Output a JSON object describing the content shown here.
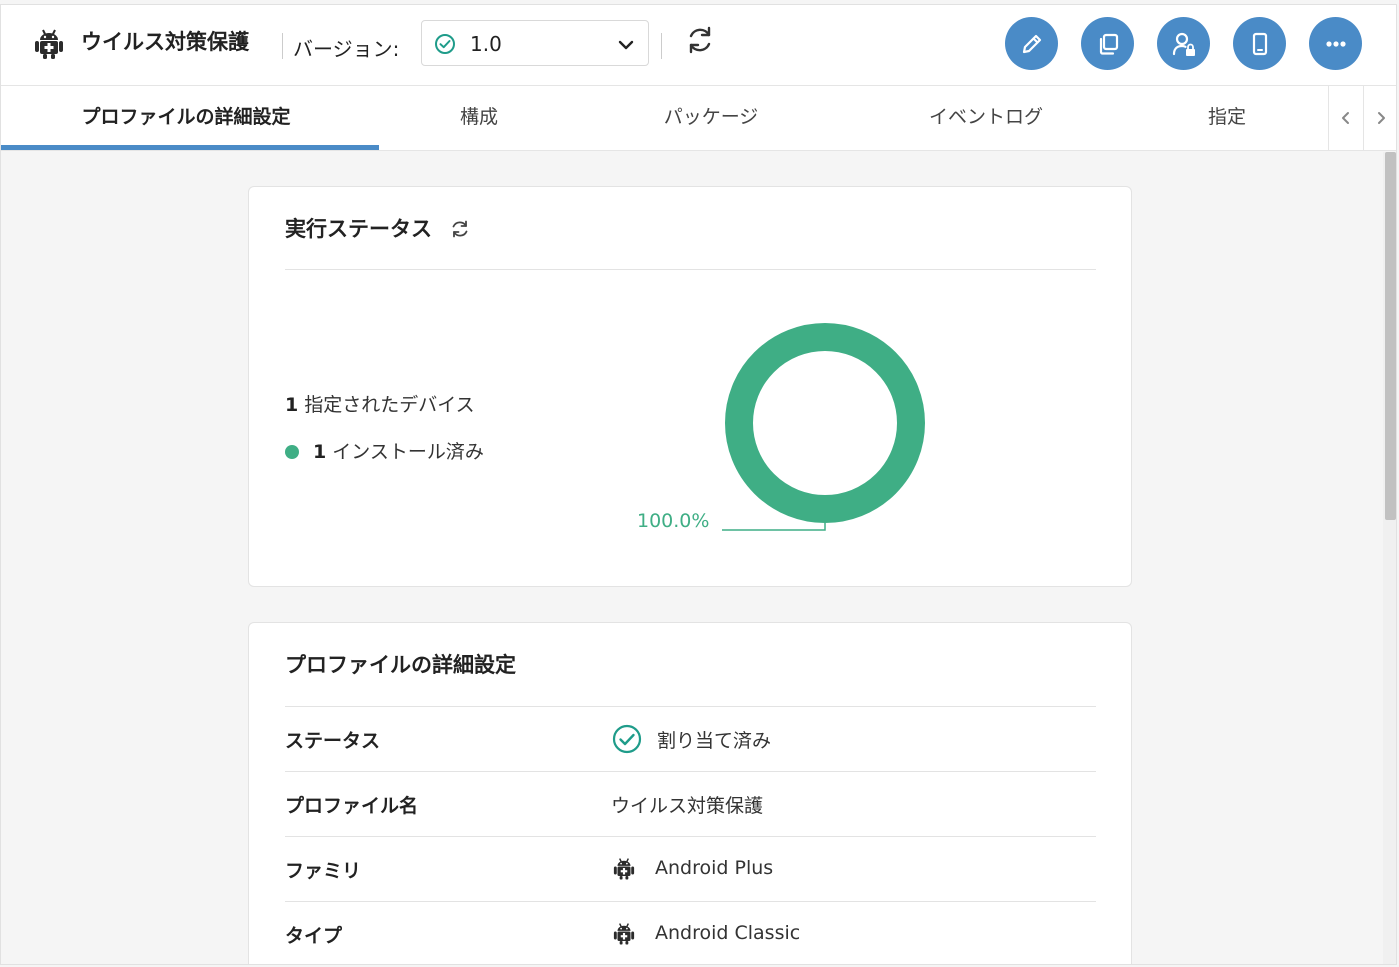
{
  "header": {
    "title": "ウイルス対策保護",
    "version_label": "バージョン:",
    "version_value": "1.0",
    "icons": [
      "android-icon",
      "check-circle-icon",
      "chevron-down-icon",
      "refresh-icon",
      "edit-icon",
      "copy-icon",
      "user-lock-icon",
      "device-icon",
      "more-icon"
    ],
    "accent_color": "#4a8bc7"
  },
  "tabs": {
    "items": [
      "プロファイルの詳細設定",
      "構成",
      "パッケージ",
      "イベントログ",
      "指定"
    ],
    "active_index": 0
  },
  "status_card": {
    "title": "実行ステータス",
    "assigned_count": "1",
    "assigned_label": "指定されたデバイス",
    "installed_count": "1",
    "installed_label": "インストール済み",
    "installed_color": "#3fae85",
    "chart_data": {
      "type": "pie",
      "variant": "donut",
      "categories": [
        "インストール済み"
      ],
      "values": [
        100.0
      ],
      "labels": [
        "100.0%"
      ],
      "colors": [
        "#3fae85"
      ]
    }
  },
  "details_card": {
    "title": "プロファイルの詳細設定",
    "rows": [
      {
        "label": "ステータス",
        "value": "割り当て済み",
        "icon": "check-circle-icon"
      },
      {
        "label": "プロファイル名",
        "value": "ウイルス対策保護",
        "icon": ""
      },
      {
        "label": "ファミリ",
        "value": "Android Plus",
        "icon": "android-icon"
      },
      {
        "label": "タイプ",
        "value": "Android Classic",
        "icon": "android-icon"
      }
    ]
  }
}
